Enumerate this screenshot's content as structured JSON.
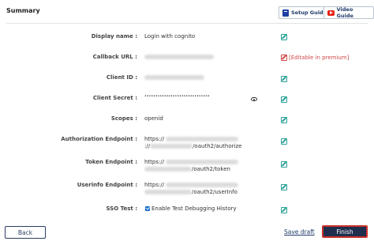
{
  "header": {
    "title": "Summary",
    "setup_guide": "Setup Guide",
    "video_guide": "Video Guide"
  },
  "fields": {
    "display_name": {
      "label": "Display name :",
      "value": "Login with cognito"
    },
    "callback_url": {
      "label": "Callback URL :",
      "note": "[Editable in premium]"
    },
    "client_id": {
      "label": "Client ID :"
    },
    "client_secret": {
      "label": "Client Secret :",
      "value": "••••••••••••••••••••••••••••••"
    },
    "scopes": {
      "label": "Scopes :",
      "value": "openid"
    },
    "authorization_endpoint": {
      "label": "Authorization Endpoint :",
      "line1_prefix": "https://",
      "line2_prefix": "://",
      "line2_suffix": "/oauth2/authorize"
    },
    "token_endpoint": {
      "label": "Token Endpoint :",
      "line1_prefix": "https://",
      "line2_suffix": "/oauth2/token"
    },
    "userinfo_endpoint": {
      "label": "Userinfo Endpoint :",
      "line1_prefix": "https://",
      "line2_suffix": "/oauth2/userInfo"
    },
    "sso_test": {
      "label": "SSO Test :",
      "checkbox_label": "Enable Test Debugging History",
      "checked": true
    }
  },
  "footer": {
    "back": "Back",
    "save_draft": "Save draft",
    "finish": "Finish"
  },
  "colors": {
    "edit_icon": "#2aa197",
    "premium_text": "#d04848",
    "finish_bg": "#1f2e4d",
    "finish_border": "#c9312c"
  }
}
